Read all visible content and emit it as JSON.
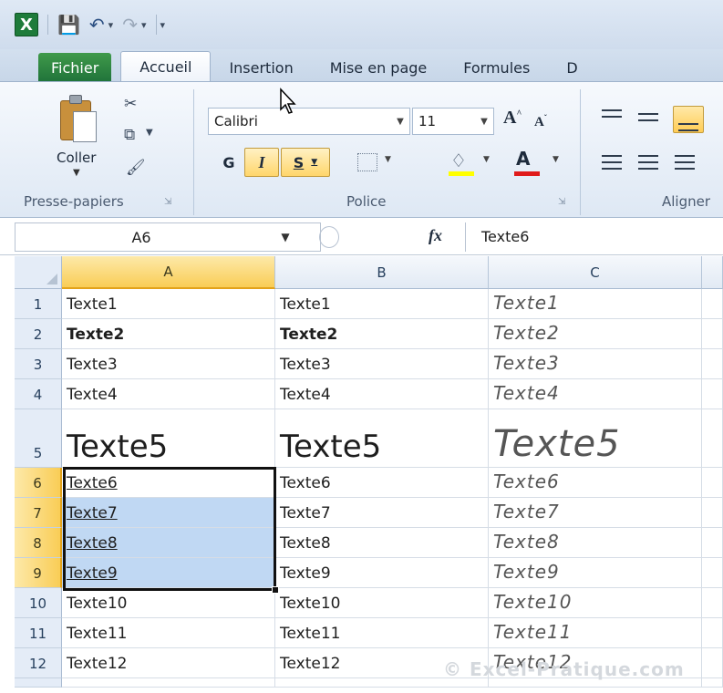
{
  "qat": {
    "logo": "X",
    "save_icon": "save-icon",
    "undo_icon": "undo-icon",
    "redo_icon": "redo-icon"
  },
  "tabs": [
    {
      "label": "Fichier"
    },
    {
      "label": "Accueil"
    },
    {
      "label": "Insertion"
    },
    {
      "label": "Mise en page"
    },
    {
      "label": "Formules"
    },
    {
      "label": "D"
    }
  ],
  "ribbon": {
    "clipboard": {
      "paste_label": "Coller",
      "group_label": "Presse-papiers"
    },
    "font": {
      "font_name": "Calibri",
      "font_size": "11",
      "bold_label": "G",
      "italic_label": "I",
      "underline_label": "S",
      "font_color_label": "A",
      "group_label": "Police"
    },
    "alignment": {
      "group_label": "Aligner"
    }
  },
  "formula_bar": {
    "name_box": "A6",
    "fx_label": "fx",
    "value": "Texte6"
  },
  "grid": {
    "columns": [
      "A",
      "B",
      "C"
    ],
    "rows": [
      {
        "num": "1",
        "a": "Texte1",
        "b": "Texte1",
        "c": "Texte1"
      },
      {
        "num": "2",
        "a": "Texte2",
        "b": "Texte2",
        "c": "Texte2"
      },
      {
        "num": "3",
        "a": "Texte3",
        "b": "Texte3",
        "c": "Texte3"
      },
      {
        "num": "4",
        "a": "Texte4",
        "b": "Texte4",
        "c": "Texte4"
      },
      {
        "num": "5",
        "a": "Texte5",
        "b": "Texte5",
        "c": "Texte5"
      },
      {
        "num": "6",
        "a": "Texte6",
        "b": "Texte6",
        "c": "Texte6"
      },
      {
        "num": "7",
        "a": "Texte7",
        "b": "Texte7",
        "c": "Texte7"
      },
      {
        "num": "8",
        "a": "Texte8",
        "b": "Texte8",
        "c": "Texte8"
      },
      {
        "num": "9",
        "a": "Texte9",
        "b": "Texte9",
        "c": "Texte9"
      },
      {
        "num": "10",
        "a": "Texte10",
        "b": "Texte10",
        "c": "Texte10"
      },
      {
        "num": "11",
        "a": "Texte11",
        "b": "Texte11",
        "c": "Texte11"
      },
      {
        "num": "12",
        "a": "Texte12",
        "b": "Texte12",
        "c": "Texte12"
      }
    ]
  },
  "watermark": "© Excel-Pratique.com"
}
